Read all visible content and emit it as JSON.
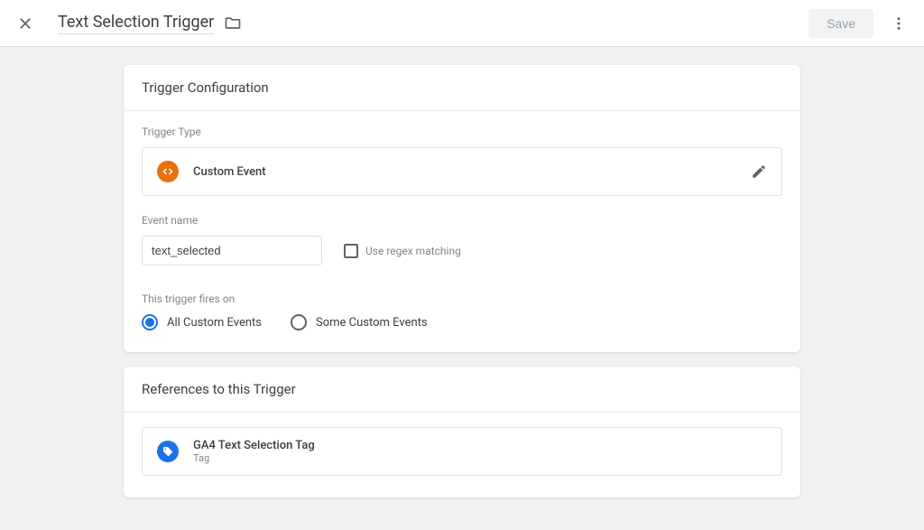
{
  "header": {
    "title": "Text Selection Trigger",
    "save_label": "Save"
  },
  "config": {
    "card_title": "Trigger Configuration",
    "trigger_type_label": "Trigger Type",
    "trigger_type_name": "Custom Event",
    "event_name_label": "Event name",
    "event_name_value": "text_selected",
    "regex_label": "Use regex matching",
    "fires_on_label": "This trigger fires on",
    "fires_on_options": [
      {
        "label": "All Custom Events",
        "selected": true
      },
      {
        "label": "Some Custom Events",
        "selected": false
      }
    ]
  },
  "references": {
    "card_title": "References to this Trigger",
    "items": [
      {
        "title": "GA4 Text Selection Tag",
        "sub": "Tag"
      }
    ]
  }
}
